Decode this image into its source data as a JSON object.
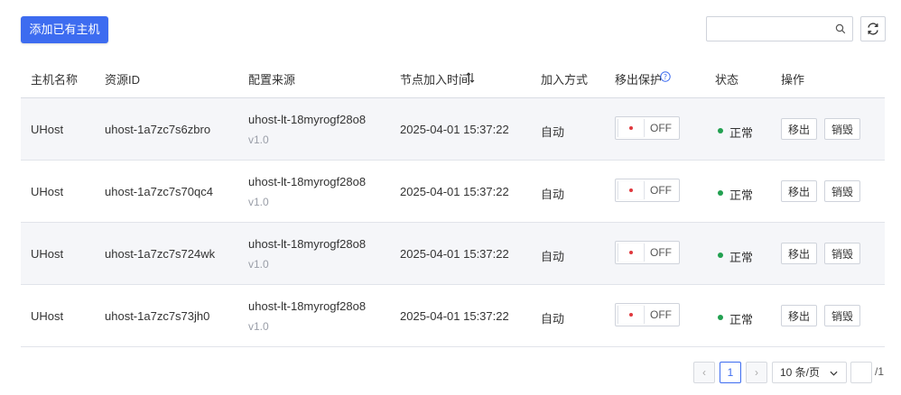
{
  "toolbar": {
    "add_button_label": "添加已有主机",
    "search_placeholder": "",
    "search_icon": "search-icon",
    "refresh_icon": "refresh-icon"
  },
  "table": {
    "columns": [
      "主机名称",
      "资源ID",
      "配置来源",
      "节点加入时间",
      "加入方式",
      "移出保护",
      "状态",
      "操作"
    ],
    "rows": [
      {
        "name": "UHost",
        "resource_id": "uhost-1a7zc7s6zbro",
        "config": "uhost-lt-18myrogf28o8",
        "version": "v1.0",
        "join_time": "2025-04-01 15:37:22",
        "join_method": "自动",
        "protection": "OFF",
        "status": "正常",
        "action_remove": "移出",
        "action_destroy": "销毁"
      },
      {
        "name": "UHost",
        "resource_id": "uhost-1a7zc7s70qc4",
        "config": "uhost-lt-18myrogf28o8",
        "version": "v1.0",
        "join_time": "2025-04-01 15:37:22",
        "join_method": "自动",
        "protection": "OFF",
        "status": "正常",
        "action_remove": "移出",
        "action_destroy": "销毁"
      },
      {
        "name": "UHost",
        "resource_id": "uhost-1a7zc7s724wk",
        "config": "uhost-lt-18myrogf28o8",
        "version": "v1.0",
        "join_time": "2025-04-01 15:37:22",
        "join_method": "自动",
        "protection": "OFF",
        "status": "正常",
        "action_remove": "移出",
        "action_destroy": "销毁"
      },
      {
        "name": "UHost",
        "resource_id": "uhost-1a7zc7s73jh0",
        "config": "uhost-lt-18myrogf28o8",
        "version": "v1.0",
        "join_time": "2025-04-01 15:37:22",
        "join_method": "自动",
        "protection": "OFF",
        "status": "正常",
        "action_remove": "移出",
        "action_destroy": "销毁"
      }
    ]
  },
  "pagination": {
    "prev_label": "‹",
    "current_page": "1",
    "next_label": "›",
    "page_size_label": "10 条/页",
    "page_input": "",
    "total_pages": "/1"
  },
  "colors": {
    "primary": "#3d6cf0",
    "status_ok": "#22a050",
    "toggle_dot": "#e0393e"
  }
}
